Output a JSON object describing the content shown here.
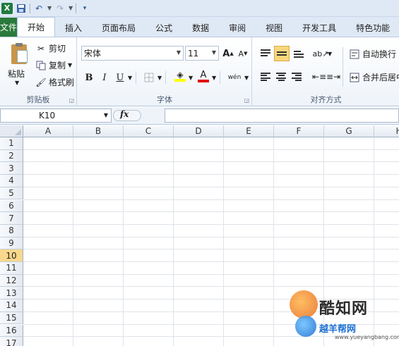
{
  "qat": {
    "logo": "X",
    "icons": [
      "save-icon",
      "undo-icon",
      "redo-icon",
      "customize-icon"
    ]
  },
  "tabs": [
    {
      "label": "文件"
    },
    {
      "label": "开始"
    },
    {
      "label": "插入"
    },
    {
      "label": "页面布局"
    },
    {
      "label": "公式"
    },
    {
      "label": "数据"
    },
    {
      "label": "审阅"
    },
    {
      "label": "视图"
    },
    {
      "label": "开发工具"
    },
    {
      "label": "特色功能"
    }
  ],
  "clipboard": {
    "paste": "粘贴",
    "cut": "剪切",
    "copy": "复制",
    "format_painter": "格式刷",
    "label": "剪贴板"
  },
  "font": {
    "name": "宋体",
    "size": "11",
    "grow": "A",
    "shrink": "A",
    "bold": "B",
    "italic": "I",
    "underline": "U",
    "color_letter": "A",
    "phonetic": "wén",
    "label": "字体"
  },
  "alignment": {
    "wrap": "自动换行",
    "merge": "合并后居中",
    "label": "对齐方式"
  },
  "formula_bar": {
    "name_box": "K10",
    "fx": "fx",
    "value": ""
  },
  "grid": {
    "columns": [
      "A",
      "B",
      "C",
      "D",
      "E",
      "F",
      "G",
      "H"
    ],
    "rows": [
      "1",
      "2",
      "3",
      "4",
      "5",
      "6",
      "7",
      "8",
      "9",
      "10",
      "11",
      "12",
      "13",
      "14",
      "15",
      "16",
      "17"
    ],
    "selected_row": "10"
  },
  "watermark": {
    "brand": "酷知网",
    "brand2": "越羊帮网",
    "url": "www.yueyangbang.com"
  },
  "colors": {
    "file_tab": "#2a7a3b",
    "selected_row": "#f9d88c",
    "ribbon_bg": "#dfe9f5"
  }
}
